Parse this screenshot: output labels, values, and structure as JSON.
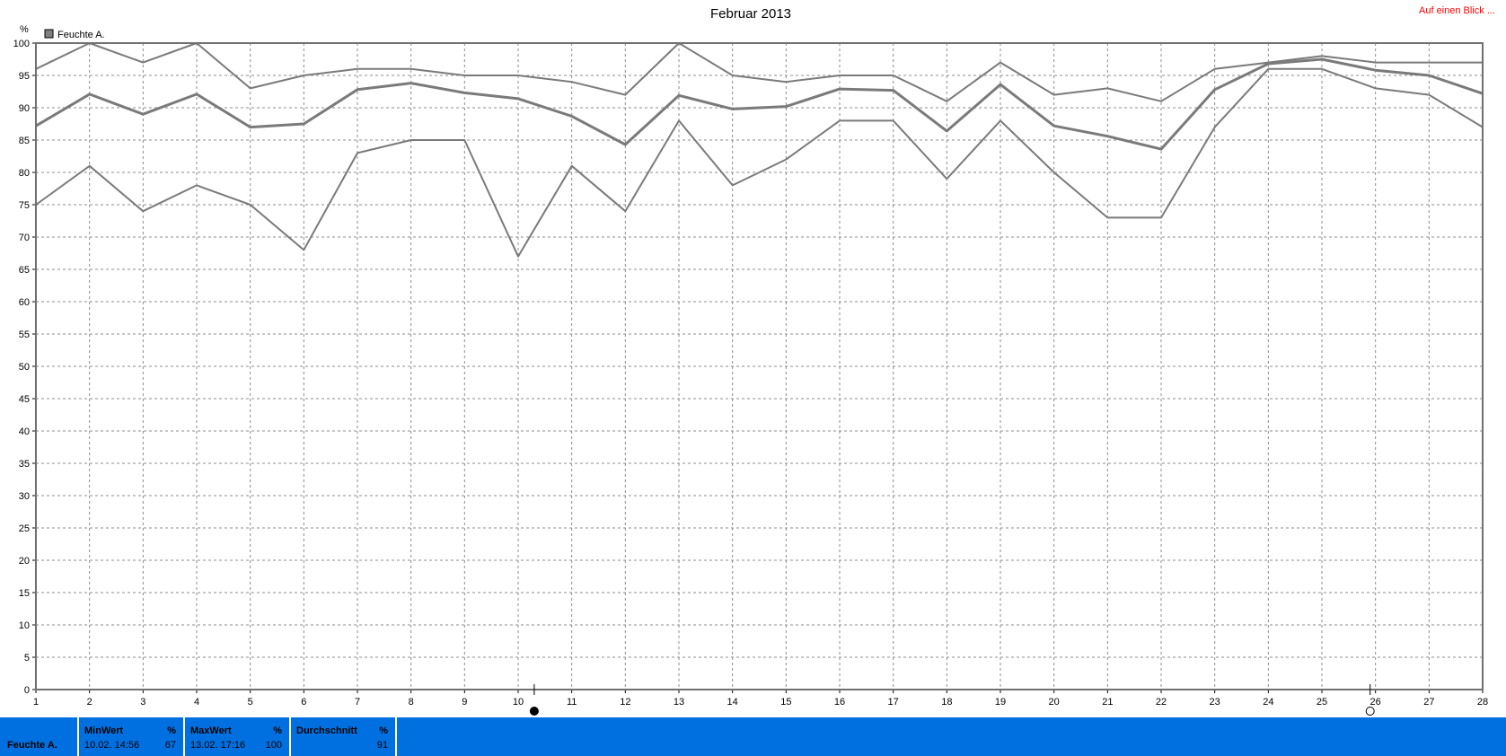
{
  "title": "Februar 2013",
  "link_label": "Auf einen Blick ...",
  "legend": {
    "label": "Feuchte A.",
    "swatch_color": "#808080"
  },
  "colors": {
    "series": "#7a7a7a",
    "grid": "#8c8c8c",
    "footer_bg": "#0070e0",
    "link": "#ff0000"
  },
  "chart_data": {
    "type": "line",
    "title": "Februar 2013",
    "ylabel": "%",
    "xlabel": "",
    "ylim": [
      0,
      100
    ],
    "y_ticks": [
      0,
      5,
      10,
      15,
      20,
      25,
      30,
      35,
      40,
      45,
      50,
      55,
      60,
      65,
      70,
      75,
      80,
      85,
      90,
      95,
      100
    ],
    "x": [
      1,
      2,
      3,
      4,
      5,
      6,
      7,
      8,
      9,
      10,
      11,
      12,
      13,
      14,
      15,
      16,
      17,
      18,
      19,
      20,
      21,
      22,
      23,
      24,
      25,
      26,
      27,
      28
    ],
    "grid": true,
    "legend_position": "top-left",
    "series": [
      {
        "name": "Feuchte A.",
        "role": "max",
        "values": [
          96,
          100,
          97,
          100,
          93,
          95,
          96,
          96,
          95,
          95,
          94,
          92,
          100,
          95,
          94,
          95,
          95,
          91,
          97,
          92,
          93,
          91,
          96,
          97,
          98,
          97,
          97,
          97
        ]
      },
      {
        "name": "Feuchte A.",
        "role": "avg",
        "values": [
          87.2,
          92.1,
          89,
          92.1,
          87,
          87.5,
          92.8,
          93.8,
          92.3,
          91.4,
          88.7,
          84.3,
          91.9,
          89.8,
          90.2,
          92.9,
          92.7,
          86.4,
          93.6,
          87.2,
          85.6,
          83.6,
          92.8,
          96.8,
          97.5,
          95.8,
          95,
          92.2
        ]
      },
      {
        "name": "Feuchte A.",
        "role": "min",
        "values": [
          75,
          81,
          74,
          78,
          75,
          68,
          83,
          85,
          85,
          67,
          81,
          74,
          88,
          78,
          82,
          88,
          88,
          79,
          88,
          80,
          73,
          73,
          87,
          96,
          96,
          93,
          92,
          87
        ]
      }
    ],
    "markers": [
      {
        "type": "full-moon",
        "x": 10.3
      },
      {
        "type": "new-moon",
        "x": 25.9
      }
    ]
  },
  "footer": {
    "row_label": "Feuchte A.",
    "min": {
      "header": "MinWert",
      "unit": "%",
      "date": "10.02.  14:56",
      "value": "67"
    },
    "max": {
      "header": "MaxWert",
      "unit": "%",
      "date": "13.02.  17:16",
      "value": "100"
    },
    "avg": {
      "header": "Durchschnitt",
      "unit": "%",
      "value": "91"
    }
  }
}
